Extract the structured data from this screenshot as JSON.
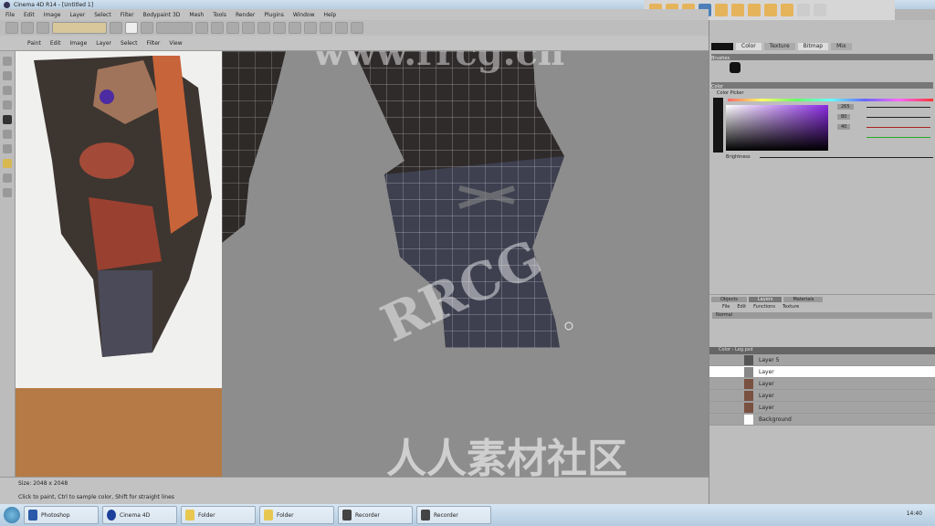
{
  "window": {
    "title": "Cinema 4D R14 - [Untitled 1]"
  },
  "menu": [
    "File",
    "Edit",
    "Image",
    "Layer",
    "Select",
    "Filter",
    "Bodypaint 3D",
    "Mesh",
    "Tools",
    "Render",
    "Plugins",
    "Window",
    "Help"
  ],
  "tabs": [
    "Paint",
    "Edit",
    "Image",
    "Layer",
    "Select",
    "Filter",
    "View"
  ],
  "right_panel": {
    "top_tabs": [
      "Color",
      "Texture",
      "Bitmap",
      "Mix"
    ],
    "sections": [
      "Brushes",
      "Color",
      "Color Picker"
    ],
    "color": {
      "hue_value": "265",
      "sat": "80",
      "val": "40",
      "brightness_label": "Brightness",
      "accent": "#8a2be2"
    },
    "layer_tabs": [
      "Objects",
      "Layers",
      "Materials"
    ],
    "layer_menu": [
      "File",
      "Edit",
      "Functions",
      "Texture"
    ],
    "mode": "Normal",
    "group": "Color - Leg.psd",
    "layers": [
      {
        "name": "Layer 5",
        "selected": false
      },
      {
        "name": "Layer",
        "selected": true
      },
      {
        "name": "Layer",
        "selected": false
      },
      {
        "name": "Layer",
        "selected": false
      },
      {
        "name": "Layer",
        "selected": false
      },
      {
        "name": "Background",
        "selected": false
      }
    ]
  },
  "status": {
    "line1": "Size: 2048 x 2048",
    "line2": "Click to paint, Ctrl to sample color, Shift for straight lines"
  },
  "taskbar": {
    "items": [
      "Photoshop",
      "Cinema 4D",
      "Folder",
      "Folder",
      "Recorder",
      "Recorder"
    ],
    "clock": "14:40"
  },
  "watermark": {
    "text1": "www.rrcg.cn",
    "text2": "人人素材社区",
    "text3": "RRCG"
  }
}
